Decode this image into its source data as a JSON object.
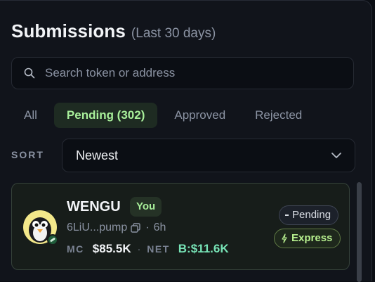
{
  "header": {
    "title": "Submissions",
    "subtitle": "(Last 30 days)"
  },
  "search": {
    "placeholder": "Search token or address",
    "value": ""
  },
  "tabs": [
    {
      "label": "All",
      "active": false
    },
    {
      "label": "Pending (302)",
      "active": true
    },
    {
      "label": "Approved",
      "active": false
    },
    {
      "label": "Rejected",
      "active": false
    }
  ],
  "sort": {
    "label": "SORT",
    "value": "Newest"
  },
  "submissions": [
    {
      "name": "WENGU",
      "owner_badge": "You",
      "address": "6LiU...pump",
      "age": "6h",
      "mc_label": "MC",
      "mc_value": "$85.5K",
      "net_label": "NET",
      "net_value": "B:$11.6K",
      "status": "Pending",
      "tier": "Express",
      "avatar_icon": "penguin-avatar"
    }
  ],
  "colors": {
    "accent_green": "#a8ef9a",
    "net_green": "#77e3b6",
    "background": "#11141b"
  },
  "icons": {
    "search": "search-icon",
    "chevron": "chevron-down-icon",
    "copy": "copy-icon",
    "bolt": "bolt-icon"
  }
}
